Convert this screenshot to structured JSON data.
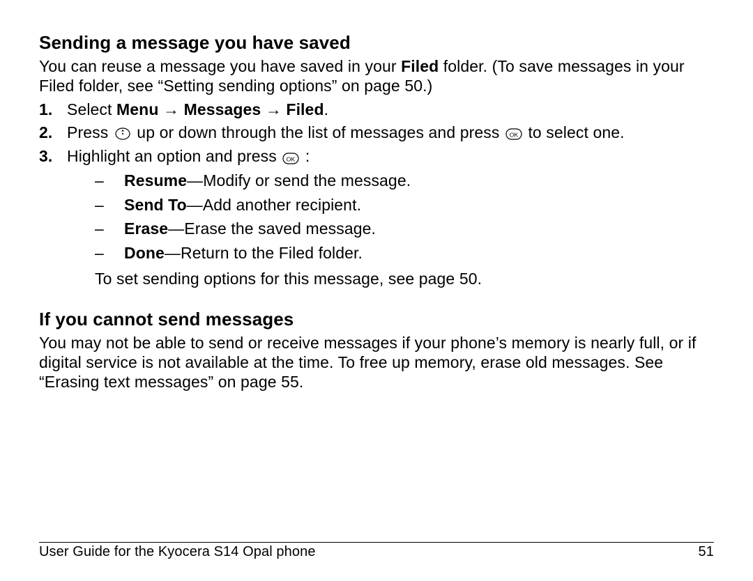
{
  "section1": {
    "heading": "Sending a message you have saved",
    "intro_a": "You can reuse a message you have saved in your ",
    "intro_bold": "Filed",
    "intro_b": " folder. (To save messages in your Filed folder, see “Setting sending options” on page 50.)",
    "step1_a": "Select ",
    "step1_b": "Menu",
    "step1_arrow": " → ",
    "step1_c": "Messages",
    "step1_d": "Filed",
    "step1_e": ".",
    "step2_a": "Press ",
    "step2_b": " up or down through the list of messages and press ",
    "step2_c": " to select one.",
    "step3_a": "Highlight an option and press ",
    "step3_b": " :",
    "opts": [
      {
        "bold": "Resume",
        "rest": "—Modify or send the message."
      },
      {
        "bold": "Send To",
        "rest": "—Add another recipient."
      },
      {
        "bold": "Erase",
        "rest": "—Erase the saved message."
      },
      {
        "bold": "Done",
        "rest": "—Return to the Filed folder."
      }
    ],
    "followup": "To set sending options for this message, see page 50."
  },
  "section2": {
    "heading": "If you cannot send messages",
    "body": "You may not be able to send or receive messages if your phone’s memory is nearly full, or if digital service is not available at the time. To free up memory, erase old messages. See “Erasing text messages” on page 55."
  },
  "footer": {
    "left": "User Guide for the Kyocera S14 Opal phone",
    "right": "51"
  }
}
